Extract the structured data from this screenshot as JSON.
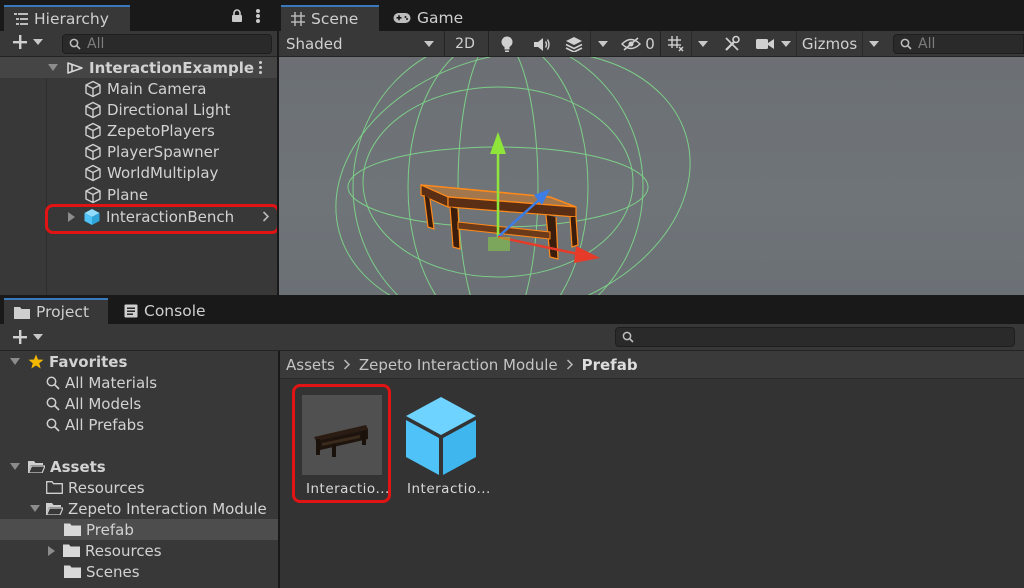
{
  "hierarchy": {
    "tab_label": "Hierarchy",
    "search_placeholder": "All",
    "scene_name": "InteractionExample",
    "items": [
      {
        "label": "Main Camera"
      },
      {
        "label": "Directional Light"
      },
      {
        "label": "ZepetoPlayers"
      },
      {
        "label": "PlayerSpawner"
      },
      {
        "label": "WorldMultiplay"
      },
      {
        "label": "Plane"
      },
      {
        "label": "InteractionBench"
      }
    ]
  },
  "scene_view": {
    "tabs": [
      {
        "label": "Scene"
      },
      {
        "label": "Game"
      }
    ],
    "shading_mode": "Shaded",
    "mode_2d": "2D",
    "hidden_count": "0",
    "gizmos_label": "Gizmos",
    "search_placeholder": "All"
  },
  "project": {
    "tabs": [
      {
        "label": "Project"
      },
      {
        "label": "Console"
      }
    ],
    "favorites": {
      "label": "Favorites",
      "items": [
        {
          "label": "All Materials"
        },
        {
          "label": "All Models"
        },
        {
          "label": "All Prefabs"
        }
      ]
    },
    "assets": {
      "label": "Assets",
      "items": [
        {
          "label": "Resources"
        },
        {
          "label": "Zepeto Interaction Module"
        },
        {
          "label": "Prefab"
        },
        {
          "label": "Resources"
        },
        {
          "label": "Scenes"
        }
      ]
    },
    "breadcrumb": [
      "Assets",
      "Zepeto Interaction Module",
      "Prefab"
    ],
    "grid_items": [
      {
        "label": "Interactio..."
      },
      {
        "label": "Interactio..."
      }
    ]
  },
  "colors": {
    "selection_blue": "#2c5d87",
    "highlight_red": "#e01414",
    "prefab_cube": "#4fc3f7"
  }
}
